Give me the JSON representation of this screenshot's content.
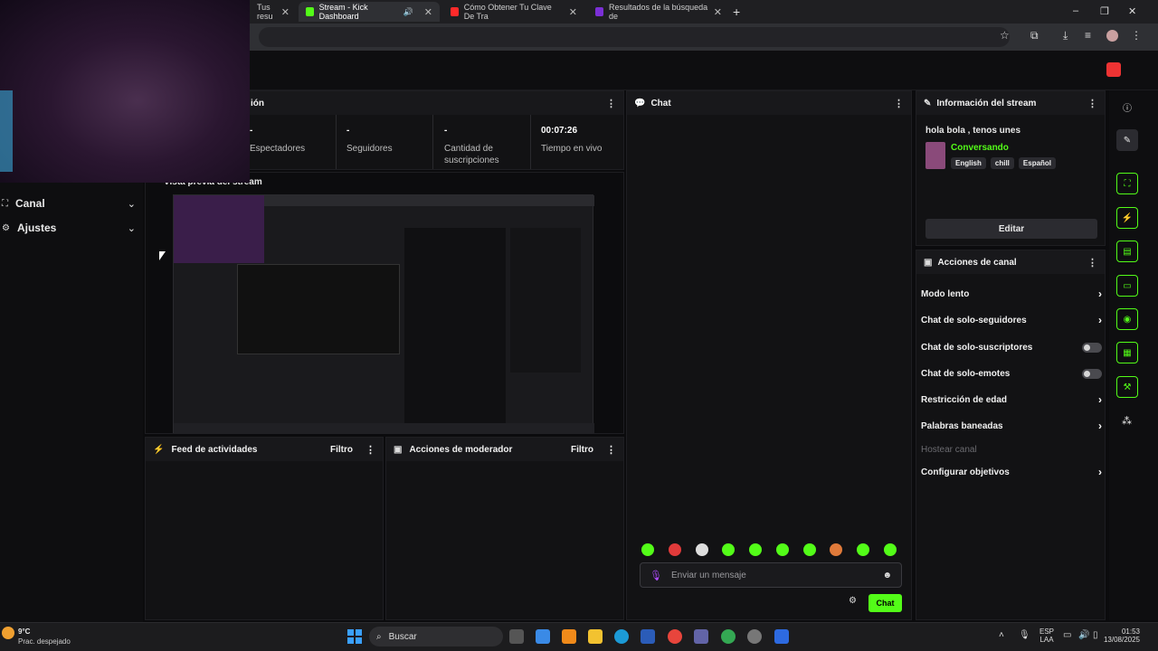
{
  "browser": {
    "tabs": [
      {
        "label": "Tus resu",
        "active": false
      },
      {
        "label": "Stream - Kick Dashboard",
        "active": true
      },
      {
        "label": "Cómo Obtener Tu Clave De Tra",
        "active": false
      },
      {
        "label": "Resultados de la búsqueda de",
        "active": false
      }
    ],
    "new_tab": "+",
    "window_controls": {
      "minimize": "–",
      "maximize": "❐",
      "close": "✕"
    }
  },
  "sidebar": {
    "items": [
      {
        "label": "Canal"
      },
      {
        "label": "Ajustes"
      }
    ]
  },
  "stats_panel": {
    "title_partial": "ión",
    "stats": [
      {
        "value": "-",
        "label": "Espectadores"
      },
      {
        "value": "-",
        "label": "Seguidores"
      },
      {
        "value": "-",
        "label": "Cantidad de suscripciones"
      },
      {
        "value": "00:07:26",
        "label": "Tiempo en vivo"
      }
    ],
    "preview_title": "Vista previa del stream"
  },
  "feed": {
    "title": "Feed de actividades",
    "filter": "Filtro"
  },
  "mod": {
    "title": "Acciones de moderador",
    "filter": "Filtro"
  },
  "chat": {
    "title": "Chat",
    "placeholder": "Enviar un mensaje",
    "send_label": "Chat"
  },
  "stream_info": {
    "title": "Información del stream",
    "stream_title": "hola bola , tenos unes",
    "category": "Conversando",
    "tags": [
      "English",
      "chill",
      "Español"
    ],
    "edit_label": "Editar"
  },
  "channel_actions": {
    "title": "Acciones de canal",
    "items": [
      {
        "label": "Modo lento",
        "control": "chevron"
      },
      {
        "label": "Chat de solo-seguidores",
        "control": "chevron"
      },
      {
        "label": "Chat de solo-suscriptores",
        "control": "toggle"
      },
      {
        "label": "Chat de solo-emotes",
        "control": "toggle"
      },
      {
        "label": "Restricción de edad",
        "control": "chevron"
      },
      {
        "label": "Palabras baneadas",
        "control": "chevron"
      },
      {
        "label": "Hostear canal",
        "control": "disabled"
      },
      {
        "label": "Configurar objetivos",
        "control": "chevron"
      }
    ]
  },
  "colors": {
    "accent": "#53fc18",
    "background": "#0b0b0d",
    "panel": "#121214"
  },
  "taskbar": {
    "weather_temp": "9°C",
    "weather_desc": "Prac. despejado",
    "search_label": "Buscar",
    "lang_top": "ESP",
    "lang_bottom": "LAA",
    "time": "01:53",
    "date": "13/08/2025"
  }
}
